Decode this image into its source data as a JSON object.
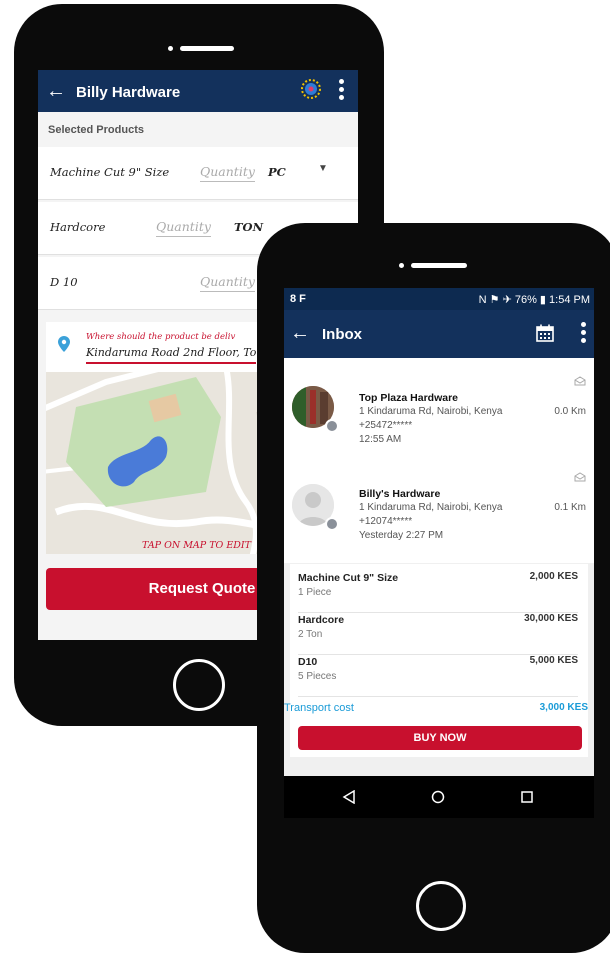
{
  "order_screen": {
    "header_title": "Billy Hardware",
    "section_label": "Selected Products",
    "products": [
      {
        "name": "Machine Cut 9\" Size",
        "quantity_placeholder": "Quantity",
        "unit": "PC"
      },
      {
        "name": "Hardcore",
        "quantity_placeholder": "Quantity",
        "unit": "TON"
      },
      {
        "name": "D 10",
        "quantity_placeholder": "Quantity",
        "unit": ""
      }
    ],
    "delivery_question": "Where should the product be deliv",
    "delivery_address": "Kindaruma Road 2nd Floor, To",
    "map_hint": "TAP ON MAP TO EDIT",
    "request_button": "Request Quote"
  },
  "inbox_screen": {
    "status_bar": {
      "carrier": "8 F",
      "battery": "N ⚑ ✈ 76% ▮ 1:54 PM"
    },
    "header_title": "Inbox",
    "messages": [
      {
        "name": "Top Plaza Hardware",
        "address": "1 Kindaruma Rd, Nairobi, Kenya",
        "phone": "+25472*****",
        "time": "12:55 AM",
        "distance": "0.0 Km"
      },
      {
        "name": "Billy's Hardware",
        "address": "1 Kindaruma Rd, Nairobi, Kenya",
        "phone": "+12074*****",
        "time": "Yesterday 2:27 PM",
        "distance": "0.1 Km"
      }
    ],
    "quote_items": [
      {
        "name": "Machine Cut 9\" Size",
        "qty": "1 Piece",
        "price": "2,000 KES"
      },
      {
        "name": "Hardcore",
        "qty": "2 Ton",
        "price": "30,000 KES"
      },
      {
        "name": "D10",
        "qty": "5 Pieces",
        "price": "5,000 KES"
      }
    ],
    "transport_label": "Transport cost",
    "transport_price": "3,000 KES",
    "buy_button": "BUY NOW"
  },
  "colors": {
    "navy": "#13315c",
    "red": "#c8102e",
    "blue": "#1a9bd7"
  }
}
